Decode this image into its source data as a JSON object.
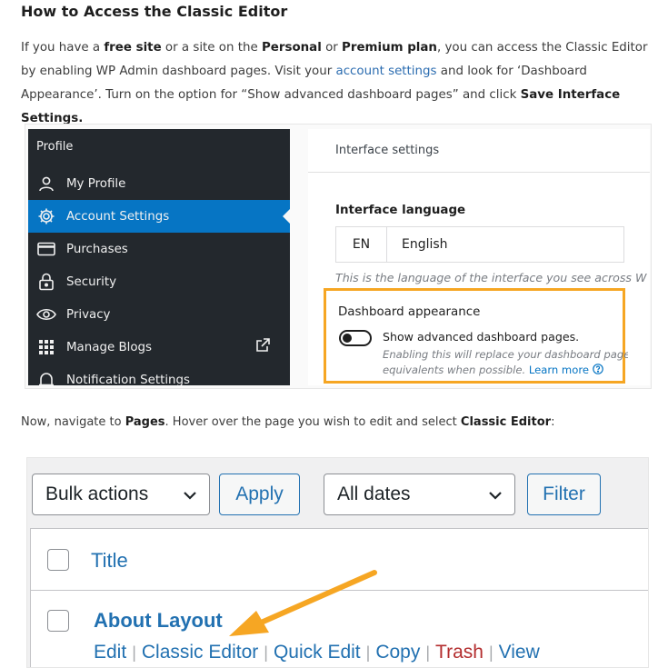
{
  "article": {
    "heading": "How to Access the Classic Editor",
    "intro": {
      "p1": "If you have a ",
      "free_site": "free site",
      "p2": " or a site on the ",
      "personal": "Personal",
      "p3": " or ",
      "premium": "Premium plan",
      "p4": ", you can access the Classic Editor by enabling WP Admin dashboard pages. Visit your ",
      "account_link": "account settings",
      "p5": " and look for ‘Dashboard Appearance’. Turn on the option for “Show advanced dashboard pages” and click ",
      "save_btn": "Save Interface Settings."
    },
    "nav": {
      "p1": "Now, navigate to ",
      "pages": "Pages",
      "p2": ". Hover over the page you wish to edit and select ",
      "classic": "Classic Editor",
      "p3": ":"
    }
  },
  "screenshot1": {
    "sidebar": {
      "header": "Profile",
      "items": [
        {
          "label": "My Profile",
          "icon": "user-icon"
        },
        {
          "label": "Account Settings",
          "icon": "gear-icon",
          "active": true
        },
        {
          "label": "Purchases",
          "icon": "credit-card-icon"
        },
        {
          "label": "Security",
          "icon": "lock-icon"
        },
        {
          "label": "Privacy",
          "icon": "eye-icon"
        },
        {
          "label": "Manage Blogs",
          "icon": "grid-icon"
        },
        {
          "label": "Notification Settings",
          "icon": "bell-icon"
        }
      ]
    },
    "panel": {
      "header": "Interface settings",
      "language_label": "Interface language",
      "language_code": "EN",
      "language_name": "English",
      "language_help": "This is the language of the interface you see across W",
      "dashboard_title": "Dashboard appearance",
      "toggle_label": "Show advanced dashboard pages.",
      "help_line1": "Enabling this will replace your dashboard pages w",
      "help_line2": "equivalents when possible.",
      "learn_more": "Learn more"
    },
    "colors": {
      "sidebar_bg": "#23282d",
      "active_bg": "#0675c4",
      "highlight": "#f6a623"
    }
  },
  "screenshot2": {
    "bulk_actions": "Bulk actions",
    "apply": "Apply",
    "all_dates": "All dates",
    "filter": "Filter",
    "column_title": "Title",
    "row_title": "About Layout",
    "actions": {
      "edit": "Edit",
      "classic": "Classic Editor",
      "quick_edit": "Quick Edit",
      "copy": "Copy",
      "trash": "Trash",
      "view": "View"
    },
    "colors": {
      "link": "#2271b1",
      "trash": "#b32d2e",
      "arrow": "#f6a623"
    }
  }
}
